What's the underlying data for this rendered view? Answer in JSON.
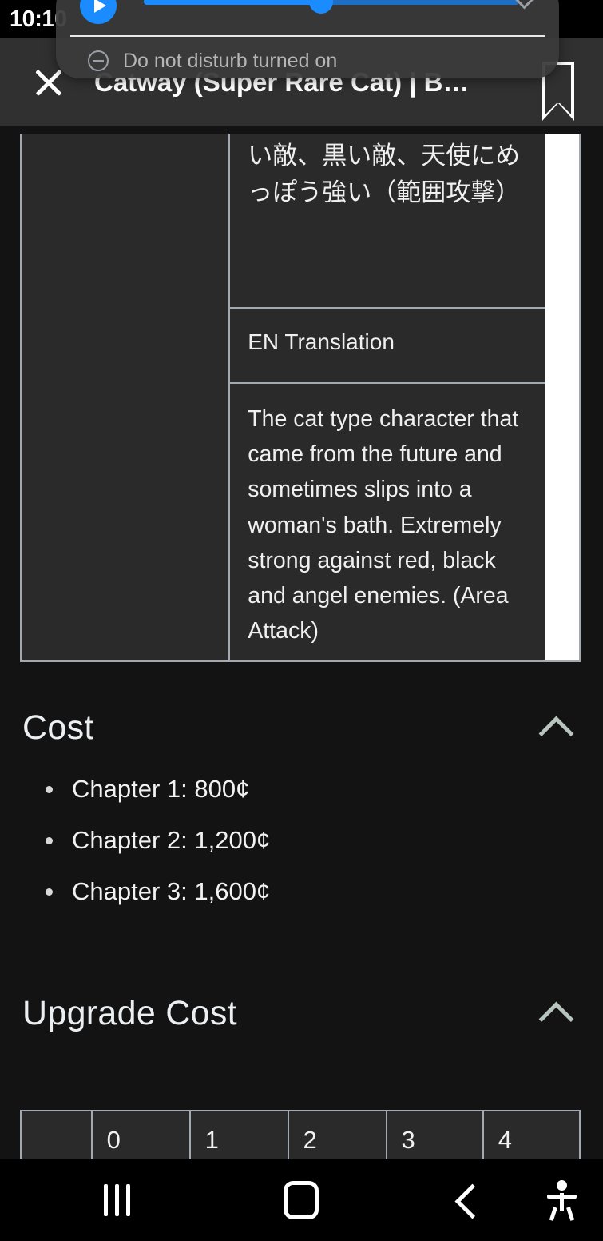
{
  "status_bar": {
    "time": "10:10",
    "icons": [
      "chat-bubble-icon",
      "owl-app-icon",
      "do-not-disturb-icon",
      "bluetooth-icon",
      "wifi-icon",
      "signal-bars-icon",
      "battery-icon"
    ]
  },
  "notification_shade": {
    "play_label": "play-icon",
    "volume_percent": 48,
    "dnd_text": "Do not disturb turned on",
    "collapse_icon": "chevron-down-icon"
  },
  "app_bar": {
    "close_label": "close-icon",
    "title": "Catway (Super Rare Cat) | B…",
    "bookmark_label": "bookmark-icon"
  },
  "wiki_table": {
    "jp_description": "い敵、黒い敵、天使にめっぽう強い（範囲攻撃）",
    "en_header": "EN Translation",
    "en_description": "The cat type character that came from the future and sometimes slips into a woman's bath. Extremely strong against red, black and angel enemies. (Area Attack)"
  },
  "cost_section": {
    "title": "Cost",
    "collapse_icon": "chevron-up-icon",
    "items": [
      "Chapter 1: 800¢",
      "Chapter 2: 1,200¢",
      "Chapter 3: 1,600¢"
    ]
  },
  "upgrade_section": {
    "title": "Upgrade Cost",
    "collapse_icon": "chevron-up-icon",
    "table_headers": [
      "",
      "0",
      "1",
      "2",
      "3",
      "4"
    ]
  },
  "nav_bar": {
    "recents": "recents-icon",
    "home": "home-icon",
    "back": "back-icon",
    "accessibility": "accessibility-icon"
  },
  "colors": {
    "page_bg": "#131313",
    "cell_bg": "#2a2a2a",
    "border": "#a2a9b1",
    "accent_blue": "#1a8cff",
    "chevron": "#b8c4be",
    "titlebar_bg": "#303030"
  }
}
